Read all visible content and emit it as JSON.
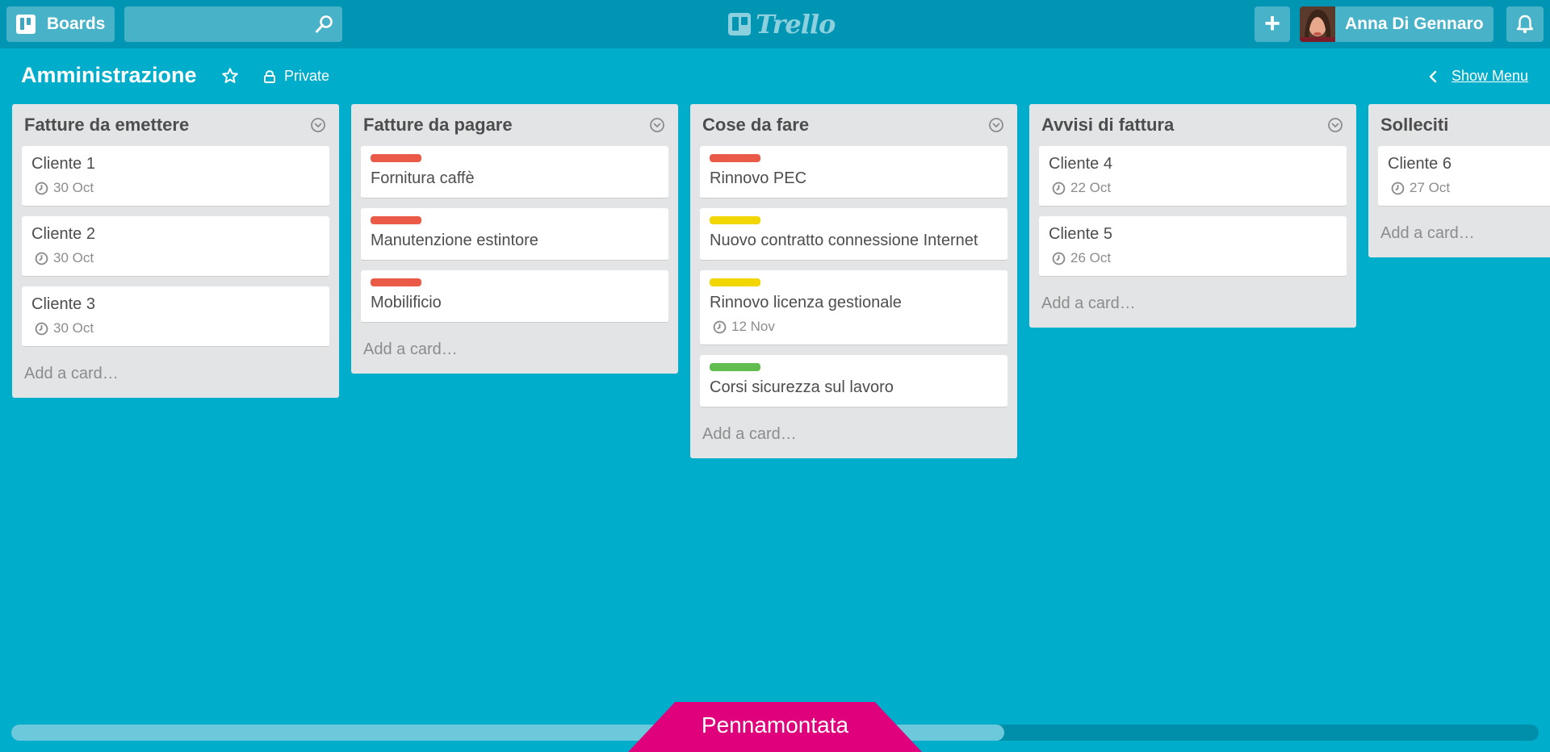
{
  "header": {
    "boards_label": "Boards",
    "search_value": "",
    "logo_text": "Trello",
    "add_label": "+",
    "user_name": "Anna Di Gennaro"
  },
  "board": {
    "title": "Amministrazione",
    "visibility": "Private",
    "show_menu": "Show Menu"
  },
  "colors": {
    "background": "#00aecc",
    "header": "#0095b3",
    "label_red": "#eb5a46",
    "label_yellow": "#f2d600",
    "label_green": "#61bd4f"
  },
  "lists": [
    {
      "title": "Fatture da emettere",
      "cards": [
        {
          "title": "Cliente 1",
          "due": "30 Oct"
        },
        {
          "title": "Cliente 2",
          "due": "30 Oct"
        },
        {
          "title": "Cliente 3",
          "due": "30 Oct"
        }
      ],
      "add_card": "Add a card…"
    },
    {
      "title": "Fatture da pagare",
      "cards": [
        {
          "title": "Fornitura caffè",
          "label": "red"
        },
        {
          "title": "Manutenzione estintore",
          "label": "red"
        },
        {
          "title": "Mobilificio",
          "label": "red"
        }
      ],
      "add_card": "Add a card…"
    },
    {
      "title": "Cose da fare",
      "cards": [
        {
          "title": "Rinnovo PEC",
          "label": "red"
        },
        {
          "title": "Nuovo contratto connessione Internet",
          "label": "yellow"
        },
        {
          "title": "Rinnovo licenza gestionale",
          "label": "yellow",
          "due": "12 Nov"
        },
        {
          "title": "Corsi sicurezza sul lavoro",
          "label": "green"
        }
      ],
      "add_card": "Add a card…"
    },
    {
      "title": "Avvisi di fattura",
      "cards": [
        {
          "title": "Cliente 4",
          "due": "22 Oct"
        },
        {
          "title": "Cliente 5",
          "due": "26 Oct"
        }
      ],
      "add_card": "Add a card…"
    },
    {
      "title": "Solleciti",
      "cards": [
        {
          "title": "Cliente 6",
          "due": "27 Oct"
        }
      ],
      "add_card": "Add a card…"
    }
  ],
  "watermark": "Pennamontata"
}
